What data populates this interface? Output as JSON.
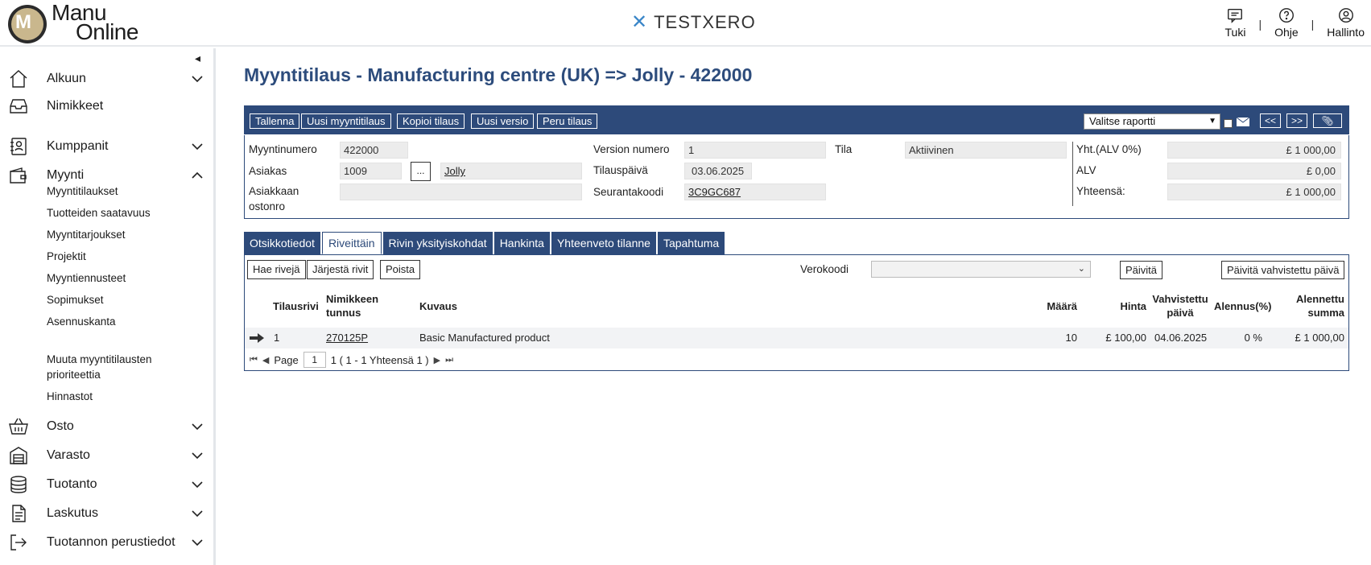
{
  "header": {
    "logo_line1": "Manu",
    "logo_line2": "Online",
    "logo_mark": "M",
    "brand": "TESTXERO",
    "links": [
      {
        "label": "Tuki",
        "icon": "chat-icon"
      },
      {
        "label": "Ohje",
        "icon": "help-icon"
      },
      {
        "label": "Hallinto",
        "icon": "user-icon"
      }
    ],
    "separator": "|"
  },
  "sidebar": {
    "collapse_glyph": "◂",
    "items": [
      {
        "label": "Alkuun",
        "icon": "home-icon",
        "chevron": "down"
      },
      {
        "label": "Nimikkeet",
        "icon": "inbox-icon",
        "chevron": ""
      },
      {
        "label": "Kumppanit",
        "icon": "contacts-icon",
        "chevron": "down"
      },
      {
        "label": "Myynti",
        "icon": "wallet-icon",
        "chevron": "up"
      },
      {
        "label": "Osto",
        "icon": "basket-icon",
        "chevron": "down"
      },
      {
        "label": "Varasto",
        "icon": "warehouse-icon",
        "chevron": "down"
      },
      {
        "label": "Tuotanto",
        "icon": "database-icon",
        "chevron": "down"
      },
      {
        "label": "Laskutus",
        "icon": "invoice-icon",
        "chevron": "down"
      },
      {
        "label": "Tuotannon perustiedot",
        "icon": "logout-icon",
        "chevron": "down"
      }
    ],
    "sub_items": [
      "Myyntitilaukset",
      "Tuotteiden saatavuus",
      "Myyntitarjoukset",
      "Projektit",
      "Myyntiennusteet",
      "Sopimukset",
      "Asennuskanta",
      "Muuta myyntitilausten prioriteettia",
      "Hinnastot"
    ]
  },
  "main": {
    "title": "Myyntitilaus - Manufacturing centre (UK) => Jolly - 422000",
    "toolbar": {
      "buttons": [
        "Tallenna",
        "Uusi myyntitilaus",
        "Kopioi tilaus",
        "Uusi versio",
        "Peru tilaus"
      ],
      "report_select": "Valitse raportti",
      "prev": "<<",
      "next": ">>"
    },
    "fields": {
      "myyntinumero_label": "Myyntinumero",
      "myyntinumero": "422000",
      "asiakas_label": "Asiakas",
      "asiakas_id": "1009",
      "asiakas_btn": "...",
      "asiakas_name": "Jolly",
      "ostonro_label_1": "Asiakkaan",
      "ostonro_label_2": "ostonro",
      "ostonro": "",
      "version_label": "Version numero",
      "version": "1",
      "tilauspaiva_label": "Tilauspäivä",
      "tilauspaiva": "03.06.2025",
      "seuranta_label": "Seurantakoodi",
      "seuranta": "3C9GC687",
      "tila_label": "Tila",
      "tila": "Aktiivinen",
      "yht_label": "Yht.(ALV 0%)",
      "yht": "£ 1 000,00",
      "alv_label": "ALV",
      "alv": "£ 0,00",
      "yhteensa_label": "Yhteensä:",
      "yhteensa": "£ 1 000,00"
    },
    "tabs": [
      {
        "label": "Otsikkotiedot",
        "active": false
      },
      {
        "label": "Riveittäin",
        "active": true
      },
      {
        "label": "Rivin yksityiskohdat",
        "active": false
      },
      {
        "label": "Hankinta",
        "active": false
      },
      {
        "label": "Yhteenveto tilanne",
        "active": false
      },
      {
        "label": "Tapahtuma",
        "active": false
      }
    ],
    "grid_toolbar": {
      "buttons": [
        "Hae rivejä",
        "Järjestä rivit",
        "Poista"
      ],
      "verokoodi_label": "Verokoodi",
      "verokoodi": "",
      "update": "Päivitä",
      "update_confirmed": "Päivitä vahvistettu päivä"
    },
    "columns": {
      "tilausrivi": "Tilausrivi",
      "nimike_1": "Nimikkeen",
      "nimike_2": "tunnus",
      "kuvaus": "Kuvaus",
      "maara": "Määrä",
      "hinta": "Hinta",
      "vahvistettu_1": "Vahvistettu",
      "vahvistettu_2": "päivä",
      "alennus": "Alennus(%)",
      "alennettu_1": "Alennettu",
      "alennettu_2": "summa"
    },
    "rows": [
      {
        "tilausrivi": "1",
        "nimike": "270125P",
        "kuvaus": "Basic Manufactured product",
        "maara": "10",
        "hinta": "£ 100,00",
        "vahvistettu": "04.06.2025",
        "alennus": "0 %",
        "summa": "£ 1 000,00"
      }
    ],
    "pager": {
      "page_label": "Page",
      "page": "1",
      "summary": "1 ( 1 - 1 Yhteensä 1 )"
    }
  },
  "colors": {
    "primary": "#2d4a7a",
    "title": "#2d4c7c",
    "brand_icon": "#3a86c8",
    "field_bg": "#ececec"
  }
}
